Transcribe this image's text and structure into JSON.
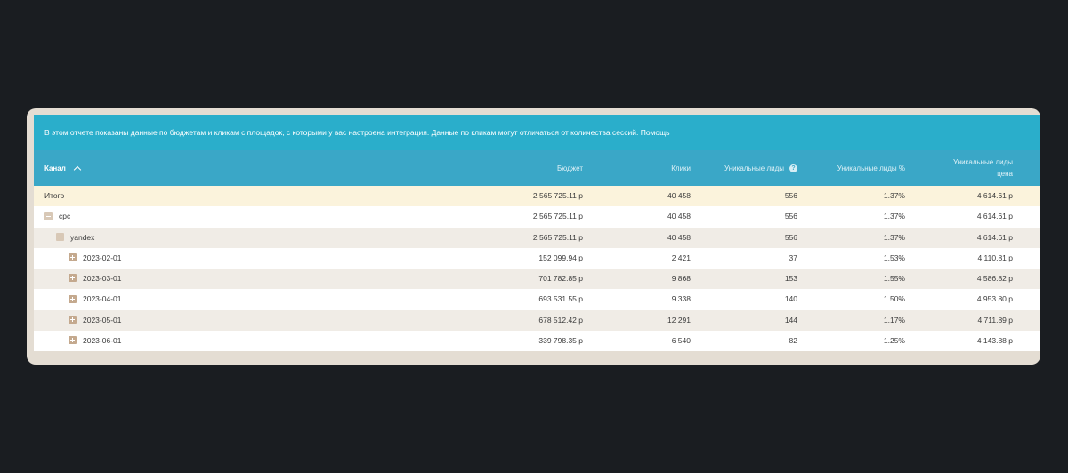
{
  "banner": {
    "text": "В этом отчете показаны данные по бюджетам и кликам с площадок, с которыми у вас настроена интеграция. Данные по кликам могут отличаться от количества сессий.",
    "help": "Помощь"
  },
  "columns": {
    "channel": "Канал",
    "budget": "Бюджет",
    "clicks": "Клики",
    "unique_leads": "Уникальные лиды",
    "unique_leads_pct": "Уникальные лиды %",
    "unique_leads_price_line1": "Уникальные лиды",
    "unique_leads_price_line2": "цена"
  },
  "rows": [
    {
      "name": "Итого",
      "budget": "2 565 725.11 р",
      "clicks": "40 458",
      "uniq": "556",
      "pct": "1.37%",
      "price": "4 614.61 р"
    },
    {
      "name": "cpc",
      "budget": "2 565 725.11 р",
      "clicks": "40 458",
      "uniq": "556",
      "pct": "1.37%",
      "price": "4 614.61 р"
    },
    {
      "name": "yandex",
      "budget": "2 565 725.11 р",
      "clicks": "40 458",
      "uniq": "556",
      "pct": "1.37%",
      "price": "4 614.61 р"
    },
    {
      "name": "2023-02-01",
      "budget": "152 099.94 р",
      "clicks": "2 421",
      "uniq": "37",
      "pct": "1.53%",
      "price": "4 110.81 р"
    },
    {
      "name": "2023-03-01",
      "budget": "701 782.85 р",
      "clicks": "9 868",
      "uniq": "153",
      "pct": "1.55%",
      "price": "4 586.82 р"
    },
    {
      "name": "2023-04-01",
      "budget": "693 531.55 р",
      "clicks": "9 338",
      "uniq": "140",
      "pct": "1.50%",
      "price": "4 953.80 р"
    },
    {
      "name": "2023-05-01",
      "budget": "678 512.42 р",
      "clicks": "12 291",
      "uniq": "144",
      "pct": "1.17%",
      "price": "4 711.89 р"
    },
    {
      "name": "2023-06-01",
      "budget": "339 798.35 р",
      "clicks": "6 540",
      "uniq": "82",
      "pct": "1.25%",
      "price": "4 143.88 р"
    }
  ]
}
